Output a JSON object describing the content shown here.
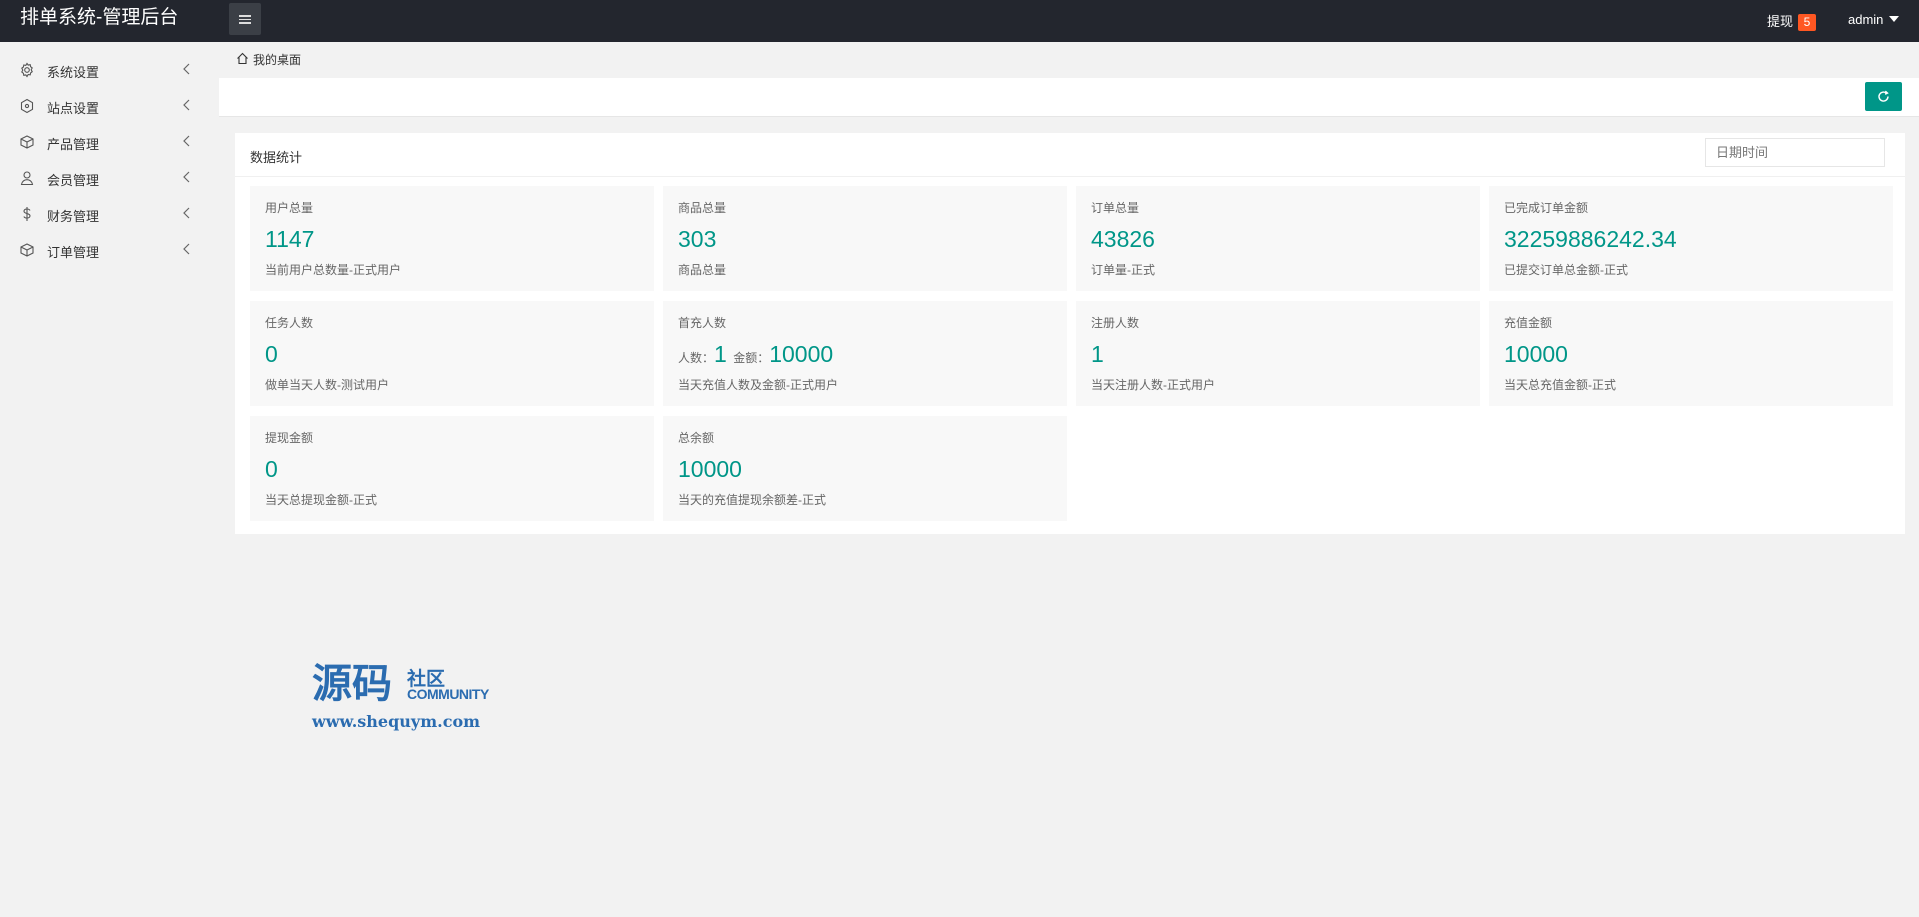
{
  "header": {
    "title": "排单系统-管理后台",
    "withdraw_label": "提现",
    "withdraw_count": "5",
    "user_name": "admin"
  },
  "sidebar": {
    "items": [
      {
        "label": "系统设置",
        "icon": "gear-icon"
      },
      {
        "label": "站点设置",
        "icon": "site-icon"
      },
      {
        "label": "产品管理",
        "icon": "box-icon"
      },
      {
        "label": "会员管理",
        "icon": "user-icon"
      },
      {
        "label": "财务管理",
        "icon": "dollar-icon"
      },
      {
        "label": "订单管理",
        "icon": "order-box-icon"
      }
    ]
  },
  "breadcrumb": {
    "label": "我的桌面"
  },
  "panel": {
    "title": "数据统计",
    "date_placeholder": "日期时间"
  },
  "stats": {
    "users": {
      "title": "用户总量",
      "value": "1147",
      "desc": "当前用户总数量-正式用户"
    },
    "products": {
      "title": "商品总量",
      "value": "303",
      "desc": "商品总量"
    },
    "orders": {
      "title": "订单总量",
      "value": "43826",
      "desc": "订单量-正式"
    },
    "completed_amount": {
      "title": "已完成订单金额",
      "value": "32259886242.34",
      "desc": "已提交订单总金额-正式"
    },
    "tasks": {
      "title": "任务人数",
      "value": "0",
      "desc": "做单当天人数-测试用户"
    },
    "first_recharge": {
      "title": "首充人数",
      "count_label": "人数：",
      "count": "1",
      "amount_label": "金额：",
      "amount": "10000",
      "desc": "当天充值人数及金额-正式用户"
    },
    "registrations": {
      "title": "注册人数",
      "value": "1",
      "desc": "当天注册人数-正式用户"
    },
    "recharge_amount": {
      "title": "充值金额",
      "value": "10000",
      "desc": "当天总充值金额-正式"
    },
    "withdraw_amount": {
      "title": "提现金额",
      "value": "0",
      "desc": "当天总提现金额-正式"
    },
    "balance": {
      "title": "总余额",
      "value": "10000",
      "desc": "当天的充值提现余额差-正式"
    }
  },
  "watermark": {
    "big_text": "源码",
    "small_text_1": "社区",
    "small_text_2": "COMMUNITY",
    "url": "www.shequym.com"
  },
  "colors": {
    "header_bg": "#23262e",
    "accent": "#009688",
    "badge": "#ff5722"
  }
}
